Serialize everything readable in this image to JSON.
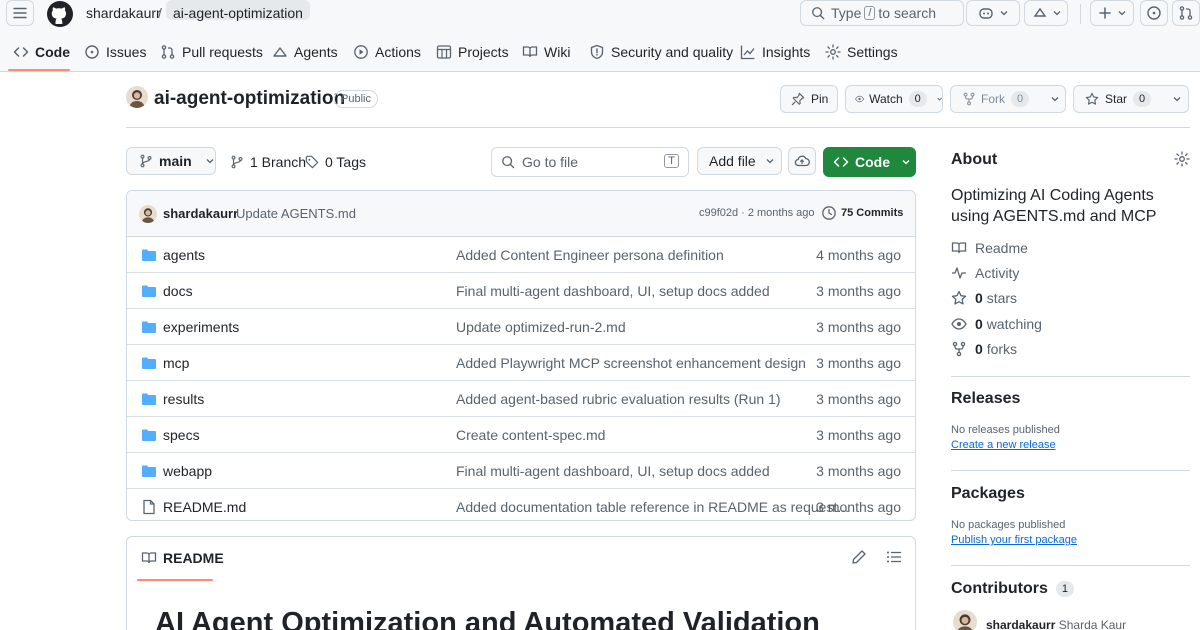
{
  "header": {
    "owner": "shardakaurr",
    "separator": "/",
    "repo": "ai-agent-optimization",
    "search": {
      "prefix": "Type",
      "key": "/",
      "suffix": "to search"
    }
  },
  "nav": [
    {
      "label": "Code",
      "icon": "code-icon"
    },
    {
      "label": "Issues",
      "icon": "issue-icon"
    },
    {
      "label": "Pull requests",
      "icon": "pull-request-icon"
    },
    {
      "label": "Agents",
      "icon": "agents-icon"
    },
    {
      "label": "Actions",
      "icon": "play-icon"
    },
    {
      "label": "Projects",
      "icon": "table-icon"
    },
    {
      "label": "Wiki",
      "icon": "book-icon"
    },
    {
      "label": "Security and quality",
      "icon": "shield-icon"
    },
    {
      "label": "Insights",
      "icon": "graph-icon"
    },
    {
      "label": "Settings",
      "icon": "gear-icon"
    }
  ],
  "repo": {
    "name": "ai-agent-optimization",
    "visibility": "Public",
    "pin_label": "Pin",
    "watch_label": "Watch",
    "watch_count": "0",
    "fork_label": "Fork",
    "fork_count": "0",
    "star_label": "Star",
    "star_count": "0"
  },
  "toolbar": {
    "branch": "main",
    "branches": "1 Branch",
    "tags": "0 Tags",
    "go_to_file_placeholder": "Go to file",
    "go_to_file_key": "T",
    "add_file": "Add file",
    "code": "Code"
  },
  "commit": {
    "author": "shardakaurr",
    "message": "Update AGENTS.md",
    "hash": "c99f02d",
    "dot": "·",
    "age": "2 months ago",
    "commits": "75 Commits"
  },
  "files": [
    {
      "name": "agents",
      "type": "dir",
      "message": "Added Content Engineer persona definition",
      "age": "4 months ago"
    },
    {
      "name": "docs",
      "type": "dir",
      "message": "Final multi-agent dashboard, UI, setup docs added",
      "age": "3 months ago"
    },
    {
      "name": "experiments",
      "type": "dir",
      "message": "Update optimized-run-2.md",
      "age": "3 months ago"
    },
    {
      "name": "mcp",
      "type": "dir",
      "message": "Added Playwright MCP screenshot enhancement design",
      "age": "3 months ago"
    },
    {
      "name": "results",
      "type": "dir",
      "message": "Added agent-based rubric evaluation results (Run 1)",
      "age": "3 months ago"
    },
    {
      "name": "specs",
      "type": "dir",
      "message": "Create content-spec.md",
      "age": "3 months ago"
    },
    {
      "name": "webapp",
      "type": "dir",
      "message": "Final multi-agent dashboard, UI, setup docs added",
      "age": "3 months ago"
    },
    {
      "name": "README.md",
      "type": "file",
      "message": "Added documentation table reference in README as request...",
      "age": "3 months ago"
    }
  ],
  "readme": {
    "tab": "README",
    "heading": "AI Agent Optimization and Automated Validation"
  },
  "about": {
    "title": "About",
    "description": "Optimizing AI Coding Agents using AGENTS.md and MCP",
    "readme": "Readme",
    "activity": "Activity",
    "stars_count": "0",
    "stars_label": "stars",
    "watching_count": "0",
    "watching_label": "watching",
    "forks_count": "0",
    "forks_label": "forks"
  },
  "releases": {
    "title": "Releases",
    "empty": "No releases published",
    "create_link": "Create a new release"
  },
  "packages": {
    "title": "Packages",
    "empty": "No packages published",
    "publish_link": "Publish your first package"
  },
  "contributors": {
    "title": "Contributors",
    "count": "1",
    "login": "shardakaurr",
    "fullname": "Sharda Kaur"
  },
  "colors": {
    "accent_link": "#0969da",
    "primary_button": "#1f883d",
    "folder": "#54aeff",
    "tab_underline": "#fd8c73"
  }
}
